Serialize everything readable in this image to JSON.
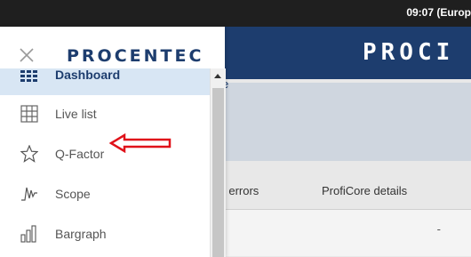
{
  "topbar": {
    "clock": "09:07 (Europ"
  },
  "header": {
    "brand": "PROCI"
  },
  "content": {
    "card_text": "e",
    "tabs": [
      "ce errors",
      "ProfiCore details"
    ],
    "row_value": "-"
  },
  "drawer": {
    "logo": "PROCENTEC",
    "items": [
      {
        "label": "Dashboard",
        "icon": "dashboard-grid-icon",
        "active": true
      },
      {
        "label": "Live list",
        "icon": "live-list-grid-icon",
        "active": false
      },
      {
        "label": "Q-Factor",
        "icon": "star-outline-icon",
        "active": false
      },
      {
        "label": "Scope",
        "icon": "waveform-icon",
        "active": false
      },
      {
        "label": "Bargraph",
        "icon": "bargraph-icon",
        "active": false
      }
    ]
  },
  "colors": {
    "brand_blue": "#1d3d6e",
    "active_bg": "#d8e6f4",
    "annotation_red": "#e0121a"
  }
}
